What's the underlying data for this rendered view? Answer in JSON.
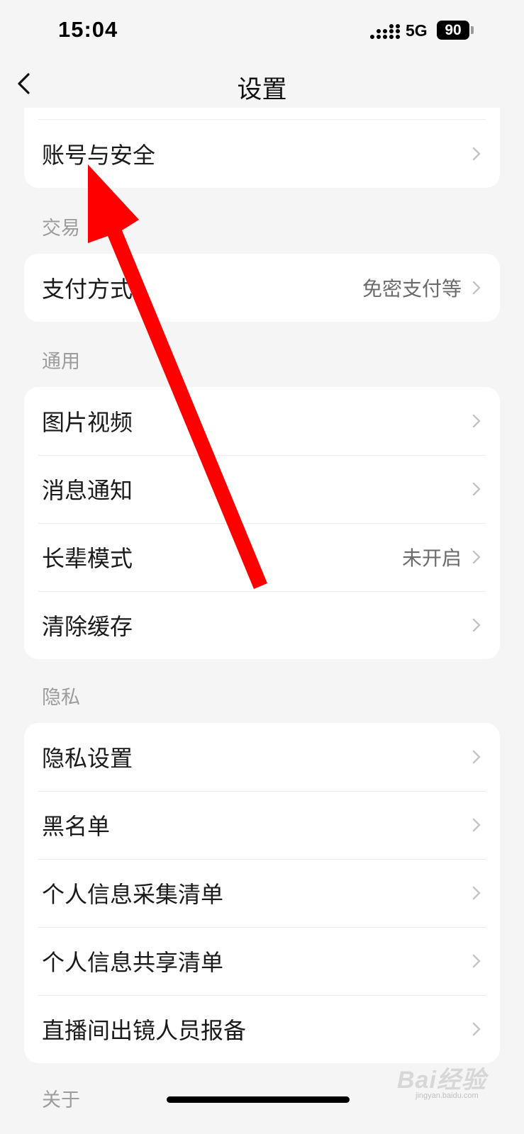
{
  "status_bar": {
    "time": "15:04",
    "network": "5G",
    "battery": "90"
  },
  "nav": {
    "title": "设置",
    "back_icon": "chevron-left-icon"
  },
  "sections": [
    {
      "key": "account",
      "items": [
        {
          "label": "账号与安全",
          "value": ""
        }
      ]
    },
    {
      "key": "trade",
      "label": "交易",
      "items": [
        {
          "label": "支付方式",
          "value": "免密支付等"
        }
      ]
    },
    {
      "key": "general",
      "label": "通用",
      "items": [
        {
          "label": "图片视频",
          "value": ""
        },
        {
          "label": "消息通知",
          "value": ""
        },
        {
          "label": "长辈模式",
          "value": "未开启"
        },
        {
          "label": "清除缓存",
          "value": ""
        }
      ]
    },
    {
      "key": "privacy",
      "label": "隐私",
      "items": [
        {
          "label": "隐私设置",
          "value": ""
        },
        {
          "label": "黑名单",
          "value": ""
        },
        {
          "label": "个人信息采集清单",
          "value": ""
        },
        {
          "label": "个人信息共享清单",
          "value": ""
        },
        {
          "label": "直播间出镜人员报备",
          "value": ""
        }
      ]
    },
    {
      "key": "about",
      "label": "关于"
    }
  ],
  "annotation": {
    "color": "#ff0000"
  },
  "watermark": {
    "brand": "Bai经验",
    "url": "jingyan.baidu.com"
  },
  "colors": {
    "background": "#f5f5f5",
    "card": "#ffffff",
    "group_label": "#9c9c9c",
    "chevron": "#c4c4c4"
  }
}
